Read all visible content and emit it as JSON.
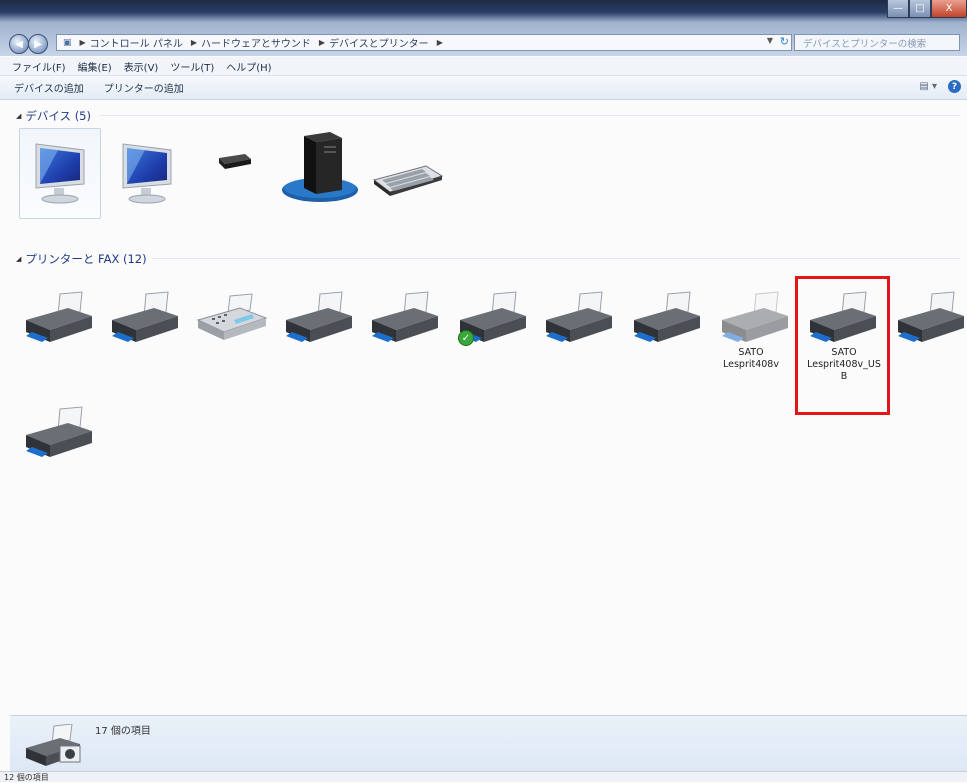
{
  "window": {
    "buttons": {
      "minimize": "—",
      "maximize": "□",
      "close": "X"
    }
  },
  "address": {
    "segments": [
      "コントロール パネル",
      "ハードウェアとサウンド",
      "デバイスとプリンター"
    ]
  },
  "search": {
    "placeholder": "デバイスとプリンターの検索"
  },
  "menu": [
    "ファイル(F)",
    "編集(E)",
    "表示(V)",
    "ツール(T)",
    "ヘルプ(H)"
  ],
  "commands": [
    "デバイスの追加",
    "プリンターの追加"
  ],
  "groups": {
    "devices": {
      "label": "デバイス (5)"
    },
    "printers": {
      "label": "プリンターと FAX (12)"
    }
  },
  "devices": [
    {
      "icon": "monitor-icon",
      "selected": true
    },
    {
      "icon": "monitor-icon"
    },
    {
      "icon": "usb-device-icon"
    },
    {
      "icon": "computer-tower-icon"
    },
    {
      "icon": "keyboard-icon"
    }
  ],
  "printers": [
    {
      "icon": "printer-icon",
      "label": ""
    },
    {
      "icon": "printer-icon",
      "label": ""
    },
    {
      "icon": "fax-icon",
      "label": ""
    },
    {
      "icon": "printer-icon",
      "label": ""
    },
    {
      "icon": "printer-icon",
      "label": ""
    },
    {
      "icon": "printer-icon",
      "label": "",
      "default": true
    },
    {
      "icon": "printer-icon",
      "label": ""
    },
    {
      "icon": "printer-icon",
      "label": ""
    },
    {
      "icon": "printer-icon",
      "label": "SATO\nLesprit408v",
      "faded": true
    },
    {
      "icon": "printer-icon",
      "label": "SATO\nLesprit408v_US\nB",
      "highlighted": true
    },
    {
      "icon": "printer-icon",
      "label": ""
    },
    {
      "icon": "printer-icon",
      "label": ""
    }
  ],
  "details": {
    "count": "17 個の項目"
  },
  "status": {
    "text": "12 個の項目"
  },
  "colors": {
    "highlight": "#e3141a",
    "group_text": "#1e3a8a"
  }
}
